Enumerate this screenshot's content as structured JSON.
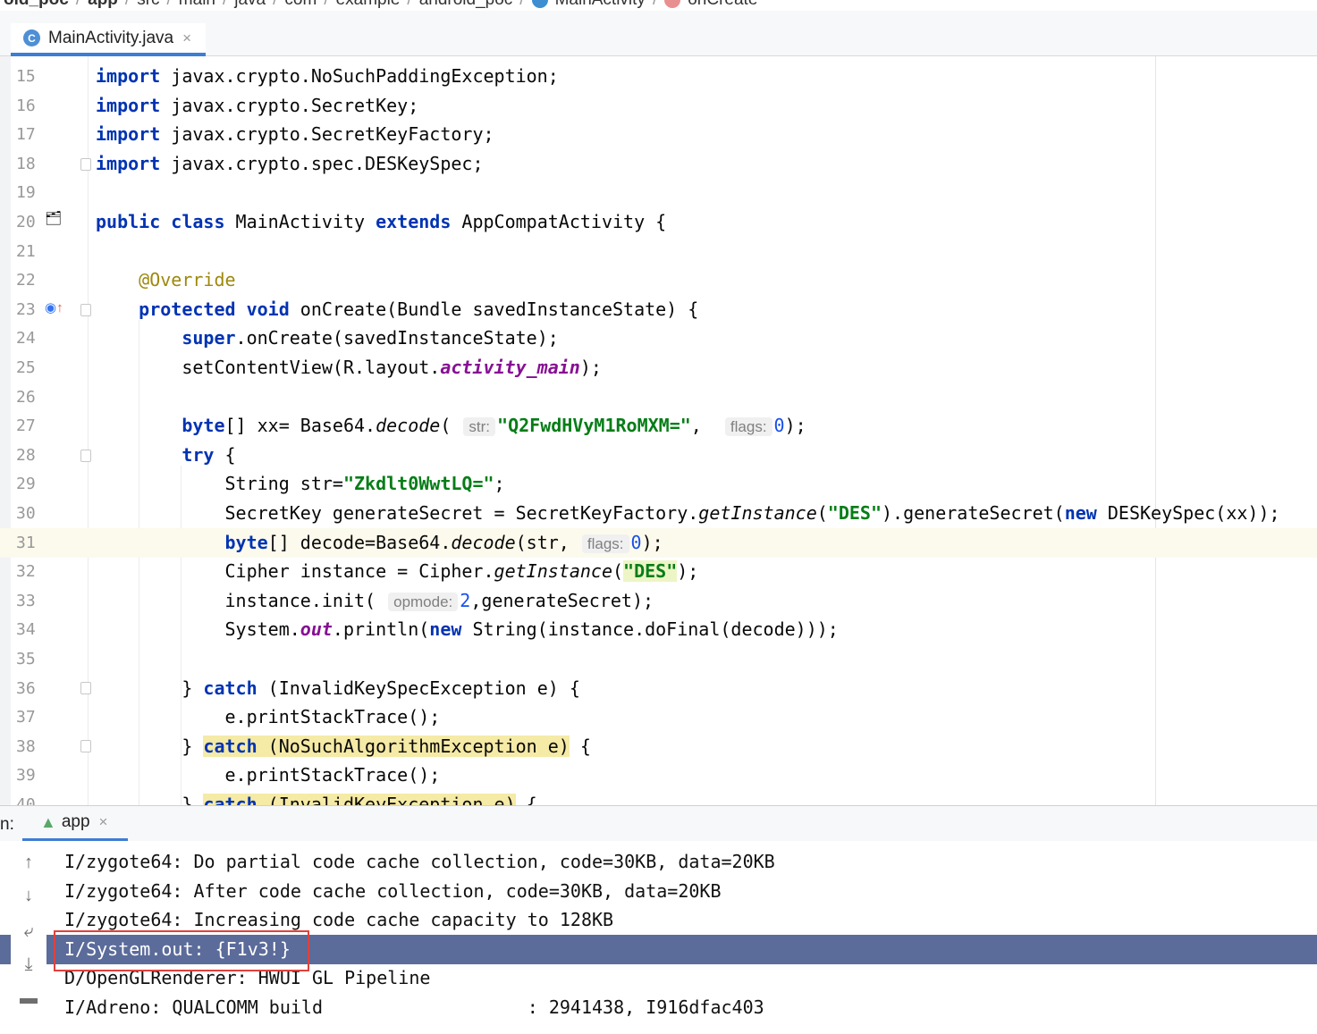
{
  "breadcrumb": {
    "items": [
      "old_poc",
      "app",
      "src",
      "main",
      "java",
      "com",
      "example",
      "android_poc",
      "MainActivity",
      "onCreate"
    ]
  },
  "tab": {
    "file_name": "MainActivity.java",
    "icon": "class-icon",
    "close": "×"
  },
  "editor": {
    "current_line": "31",
    "lines": [
      {
        "n": "15",
        "segs": [
          [
            "kw",
            "import"
          ],
          [
            "plain",
            " javax.crypto.NoSuchPaddingException;"
          ]
        ]
      },
      {
        "n": "16",
        "segs": [
          [
            "kw",
            "import"
          ],
          [
            "plain",
            " javax.crypto.SecretKey;"
          ]
        ]
      },
      {
        "n": "17",
        "segs": [
          [
            "kw",
            "import"
          ],
          [
            "plain",
            " javax.crypto.SecretKeyFactory;"
          ]
        ]
      },
      {
        "n": "18",
        "segs": [
          [
            "kw",
            "import"
          ],
          [
            "plain",
            " javax.crypto.spec.DESKeySpec;"
          ]
        ]
      },
      {
        "n": "19",
        "segs": []
      },
      {
        "n": "20",
        "segs": [
          [
            "kw",
            "public class"
          ],
          [
            "plain",
            " MainActivity "
          ],
          [
            "kw",
            "extends"
          ],
          [
            "plain",
            " AppCompatActivity {"
          ]
        ]
      },
      {
        "n": "21",
        "segs": []
      },
      {
        "n": "22",
        "segs": [
          [
            "plain",
            "    "
          ],
          [
            "ann",
            "@Override"
          ]
        ]
      },
      {
        "n": "23",
        "segs": [
          [
            "plain",
            "    "
          ],
          [
            "kw",
            "protected void"
          ],
          [
            "plain",
            " onCreate(Bundle savedInstanceState) {"
          ]
        ]
      },
      {
        "n": "24",
        "segs": [
          [
            "plain",
            "        "
          ],
          [
            "kw",
            "super"
          ],
          [
            "plain",
            ".onCreate(savedInstanceState);"
          ]
        ]
      },
      {
        "n": "25",
        "segs": [
          [
            "plain",
            "        setContentView(R.layout."
          ],
          [
            "fld",
            "activity_main"
          ],
          [
            "plain",
            ");"
          ]
        ]
      },
      {
        "n": "26",
        "segs": []
      },
      {
        "n": "27",
        "segs": [
          [
            "plain",
            "        "
          ],
          [
            "kw",
            "byte"
          ],
          [
            "plain",
            "[] xx= Base64."
          ],
          [
            "it",
            "decode"
          ],
          [
            "plain",
            "( "
          ],
          [
            "hint",
            "str:"
          ],
          [
            "str",
            "\"Q2FwdHVyM1RoMXM=\""
          ],
          [
            "plain",
            ",  "
          ],
          [
            "hint",
            "flags:"
          ],
          [
            "num",
            "0"
          ],
          [
            "plain",
            ");"
          ]
        ]
      },
      {
        "n": "28",
        "segs": [
          [
            "plain",
            "        "
          ],
          [
            "kw",
            "try"
          ],
          [
            "plain",
            " {"
          ]
        ]
      },
      {
        "n": "29",
        "segs": [
          [
            "plain",
            "            String str="
          ],
          [
            "str",
            "\"Zkdlt0WwtLQ=\""
          ],
          [
            "plain",
            ";"
          ]
        ]
      },
      {
        "n": "30",
        "segs": [
          [
            "plain",
            "            SecretKey generateSecret = SecretKeyFactory."
          ],
          [
            "it",
            "getInstance"
          ],
          [
            "plain",
            "("
          ],
          [
            "str",
            "\"DES\""
          ],
          [
            "plain",
            ").generateSecret("
          ],
          [
            "kw",
            "new"
          ],
          [
            "plain",
            " DESKeySpec(xx));"
          ]
        ]
      },
      {
        "n": "31",
        "segs": [
          [
            "plain",
            "            "
          ],
          [
            "kw",
            "byte"
          ],
          [
            "plain",
            "[] decode=Base64."
          ],
          [
            "it",
            "decode"
          ],
          [
            "plain",
            "(str, "
          ],
          [
            "hint",
            "flags:"
          ],
          [
            "num",
            "0"
          ],
          [
            "plain",
            ");"
          ]
        ]
      },
      {
        "n": "32",
        "segs": [
          [
            "plain",
            "            Cipher instance = Cipher."
          ],
          [
            "it",
            "getInstance"
          ],
          [
            "plain",
            "("
          ],
          [
            "strhl",
            "\"DES\""
          ],
          [
            "plain",
            ");"
          ]
        ]
      },
      {
        "n": "33",
        "segs": [
          [
            "plain",
            "            instance.init( "
          ],
          [
            "hint",
            "opmode:"
          ],
          [
            "num",
            "2"
          ],
          [
            "plain",
            ",generateSecret);"
          ]
        ]
      },
      {
        "n": "34",
        "segs": [
          [
            "plain",
            "            System."
          ],
          [
            "fld",
            "out"
          ],
          [
            "plain",
            ".println("
          ],
          [
            "kw",
            "new"
          ],
          [
            "plain",
            " String(instance.doFinal(decode)));"
          ]
        ]
      },
      {
        "n": "35",
        "segs": []
      },
      {
        "n": "36",
        "segs": [
          [
            "plain",
            "        } "
          ],
          [
            "kw",
            "catch"
          ],
          [
            "plain",
            " (InvalidKeySpecException e) {"
          ]
        ]
      },
      {
        "n": "37",
        "segs": [
          [
            "plain",
            "            e.printStackTrace();"
          ]
        ]
      },
      {
        "n": "38",
        "segs": [
          [
            "plain",
            "        } "
          ],
          [
            "kwhl",
            "catch"
          ],
          [
            "hl",
            " (NoSuchAlgorithmException e)"
          ],
          [
            "plain",
            " {"
          ]
        ]
      },
      {
        "n": "39",
        "segs": [
          [
            "plain",
            "            e.printStackTrace();"
          ]
        ]
      },
      {
        "n": "40",
        "segs": [
          [
            "plain",
            "        } "
          ],
          [
            "kwhl",
            "catch"
          ],
          [
            "hl",
            " (InvalidKeyException e)"
          ],
          [
            "plain",
            " {"
          ]
        ]
      }
    ]
  },
  "run": {
    "label": "n:",
    "tab_label": "app",
    "tab_close": "×",
    "selected_index": 3,
    "log": [
      "I/zygote64: Do partial code cache collection, code=30KB, data=20KB",
      "I/zygote64: After code cache collection, code=30KB, data=20KB",
      "I/zygote64: Increasing code cache capacity to 128KB",
      "I/System.out: {F1v3!}",
      "D/OpenGLRenderer: HWUI GL Pipeline",
      "I/Adreno: QUALCOMM build                   : 2941438, I916dfac403"
    ],
    "toolbar_icons": [
      "up-arrow-icon",
      "down-arrow-icon",
      "soft-wrap-icon",
      "scroll-to-end-icon",
      "print-icon"
    ]
  }
}
